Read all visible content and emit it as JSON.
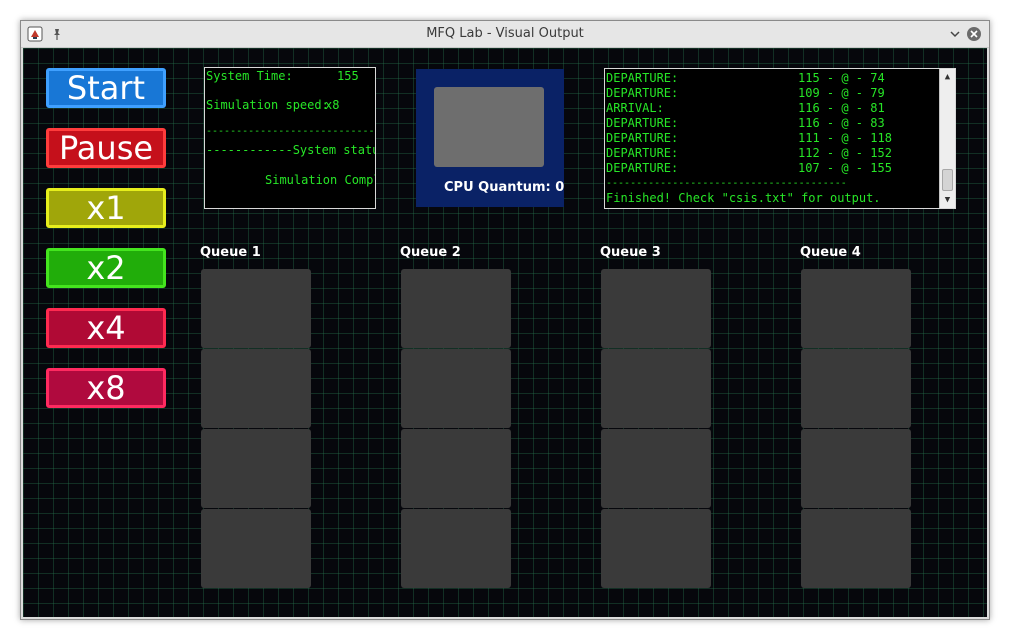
{
  "window": {
    "title": "MFQ Lab - Visual Output"
  },
  "controls": [
    {
      "label": "Start",
      "bg": "#1877d6",
      "border": "#3fa0ff"
    },
    {
      "label": "Pause",
      "bg": "#c5101b",
      "border": "#ff3c3c"
    },
    {
      "label": "x1",
      "bg": "#a0a60a",
      "border": "#e6ef1c"
    },
    {
      "label": "x2",
      "bg": "#21ad0a",
      "border": "#44e51e"
    },
    {
      "label": "x4",
      "bg": "#b00a35",
      "border": "#ff2a50"
    },
    {
      "label": "x8",
      "bg": "#b00a3e",
      "border": "#ff2a60"
    }
  ],
  "status": {
    "time_label": "System Time:",
    "time_value": "155",
    "speed_label": "Simulation speed:",
    "speed_value": "x8",
    "divider": "-----------------------------------------",
    "status_header": "------------System status---------",
    "status_text": "Simulation Complete"
  },
  "cpu": {
    "label": "CPU Quantum: 0"
  },
  "log": {
    "rows": [
      {
        "event": "DEPARTURE:",
        "detail": "115 - @ - 74"
      },
      {
        "event": "DEPARTURE:",
        "detail": "109 - @ - 79"
      },
      {
        "event": "ARRIVAL:",
        "detail": "116 - @ - 81"
      },
      {
        "event": "DEPARTURE:",
        "detail": "116 - @ - 83"
      },
      {
        "event": "DEPARTURE:",
        "detail": "111 - @ - 118"
      },
      {
        "event": "DEPARTURE:",
        "detail": "112 - @ - 152"
      },
      {
        "event": "DEPARTURE:",
        "detail": "107 - @ - 155"
      }
    ],
    "separator": "----------------------------------------",
    "finished": "Finished! Check \"csis.txt\" for output."
  },
  "queues": [
    {
      "label": "Queue 1"
    },
    {
      "label": "Queue 2"
    },
    {
      "label": "Queue 3"
    },
    {
      "label": "Queue 4"
    }
  ],
  "colors": {
    "text_green": "#27e627",
    "cpu_bg": "#0a2266",
    "slot": "#3a3a3a"
  }
}
